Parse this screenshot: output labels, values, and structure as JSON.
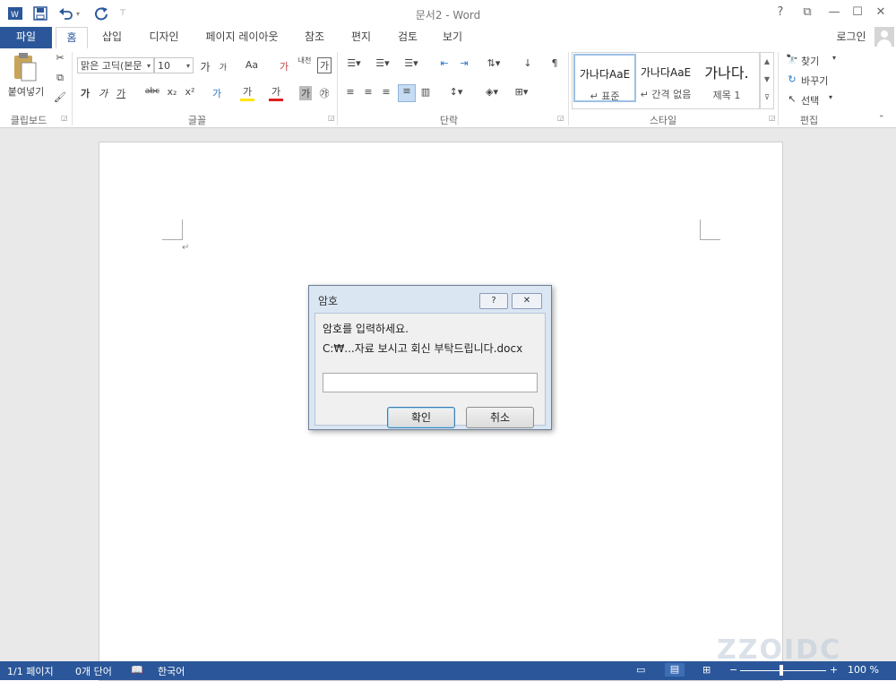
{
  "window": {
    "title": "문서2 - Word",
    "help": "?",
    "ribbon_display": "⧉",
    "minimize": "—",
    "maximize": "☐",
    "close": "✕"
  },
  "qat": {
    "customize": "⊤"
  },
  "tabs": [
    "파일",
    "홈",
    "삽입",
    "디자인",
    "페이지 레이아웃",
    "참조",
    "편지",
    "검토",
    "보기"
  ],
  "account": {
    "label": "로그인"
  },
  "ribbon": {
    "clipboard": {
      "label": "클립보드",
      "paste": "붙여넣기"
    },
    "font": {
      "label": "글꼴",
      "font_name": "맑은 고딕(본문",
      "font_size": "10",
      "grow": "가",
      "shrink": "가",
      "case": "Aa",
      "clear": "가",
      "phonetic": "내천",
      "border_char": "가",
      "bold": "가",
      "italic": "가",
      "underline": "가",
      "strike": "abc",
      "sub": "x₂",
      "sup": "x²",
      "effects": "가",
      "highlight": "가",
      "font_color": "가",
      "shade": "가",
      "enclose": "㉮"
    },
    "paragraph": {
      "label": "단락"
    },
    "styles": {
      "label": "스타일",
      "items": [
        {
          "preview": "가나다AaE",
          "name": "↵ 표준"
        },
        {
          "preview": "가나다AaE",
          "name": "↵ 간격 없음"
        },
        {
          "preview": "가나다.",
          "name": "제목 1"
        }
      ]
    },
    "editing": {
      "label": "편집",
      "find": "찾기",
      "replace": "바꾸기",
      "select": "선택"
    }
  },
  "document": {
    "paragraph_mark": "↵"
  },
  "dialog": {
    "title": "암호",
    "help": "?",
    "close": "✕",
    "prompt": "암호를 입력하세요.",
    "path": "C:₩...자료 보시고 회신 부탁드립니다.docx",
    "password_value": "",
    "ok": "확인",
    "cancel": "취소"
  },
  "status": {
    "page": "1/1 페이지",
    "words": "0개 단어",
    "language": "한국어",
    "zoom": "100 %"
  },
  "watermark": "ZZOIDC",
  "colors": {
    "accent": "#2b579a"
  }
}
